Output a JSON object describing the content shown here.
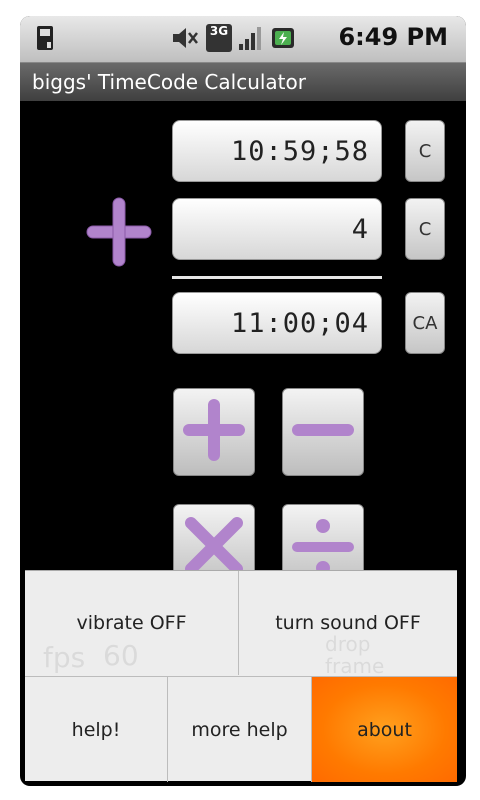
{
  "status_bar": {
    "time": "6:49 PM",
    "network": "3G"
  },
  "app": {
    "title": "biggs' TimeCode Calculator"
  },
  "timecodes": {
    "first": "10:59;58",
    "second": "4",
    "result": "11:00;04"
  },
  "clear_buttons": {
    "first": "C",
    "second": "C",
    "all": "CA"
  },
  "current_operation": "add",
  "menu": {
    "vibrate": "vibrate OFF",
    "sound": "turn sound OFF",
    "help": "help!",
    "more_help": "more help",
    "about": "about",
    "selected": "about"
  },
  "behind_menu": {
    "fps_label": "fps",
    "fps_value": "60",
    "drop_frame_label": "drop frame"
  },
  "colors": {
    "accent": "#b184cc",
    "menu_highlight": "#ff7f00",
    "title_bar": "#4f4f4f"
  }
}
